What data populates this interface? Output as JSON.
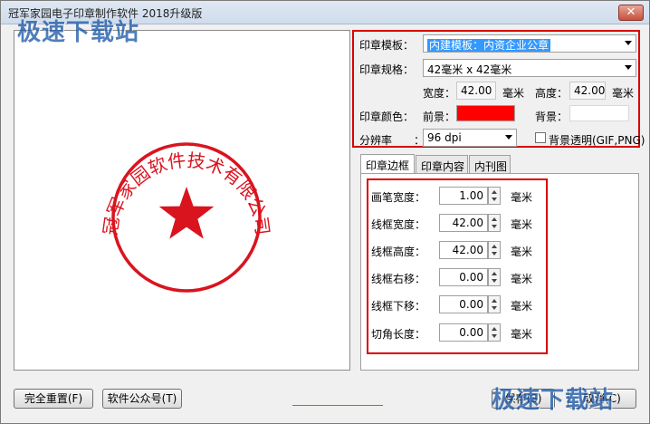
{
  "window": {
    "title": "冠军家园电子印章制作软件 2018升级版",
    "close_symbol": "✕"
  },
  "watermark": "极速下载站",
  "stamp": {
    "ring_text": "冠军家园软件技术有限公司",
    "color": "#d9141f"
  },
  "settings": {
    "template_label": "印章模板：",
    "template_value": "内建模板：内资企业公章",
    "spec_label": "印章规格：",
    "spec_value": "42毫米 x 42毫米",
    "width_label": "宽度：",
    "width_value": "42.00",
    "width_unit": "毫米",
    "height_label": "高度：",
    "height_value": "42.00",
    "height_unit": "毫米",
    "color_label": "印章颜色：",
    "foreground_label": "前景：",
    "foreground_color": "#ff0000",
    "background_label": "背景：",
    "background_color": "#ffffff",
    "resolution_label": "分辨率",
    "resolution_colon": "：",
    "resolution_value": "96 dpi",
    "transparent_label": "背景透明(GIF,PNG)"
  },
  "tabs": [
    {
      "label": "印章边框"
    },
    {
      "label": "印章内容"
    },
    {
      "label": "内刊图"
    }
  ],
  "border_fields": [
    {
      "label": "画笔宽度：",
      "value": "1.00",
      "unit": "毫米"
    },
    {
      "label": "线框宽度：",
      "value": "42.00",
      "unit": "毫米"
    },
    {
      "label": "线框高度：",
      "value": "42.00",
      "unit": "毫米"
    },
    {
      "label": "线框右移：",
      "value": "0.00",
      "unit": "毫米"
    },
    {
      "label": "线框下移：",
      "value": "0.00",
      "unit": "毫米"
    },
    {
      "label": "切角长度：",
      "value": "0.00",
      "unit": "毫米"
    }
  ],
  "buttons": {
    "reset": "完全重置(F)",
    "public_account": "软件公众号(T)",
    "save": "保存(S)",
    "cancel": "取消(C)"
  },
  "colors": {
    "highlight_box": "#d90000",
    "selection": "#3399ff"
  }
}
